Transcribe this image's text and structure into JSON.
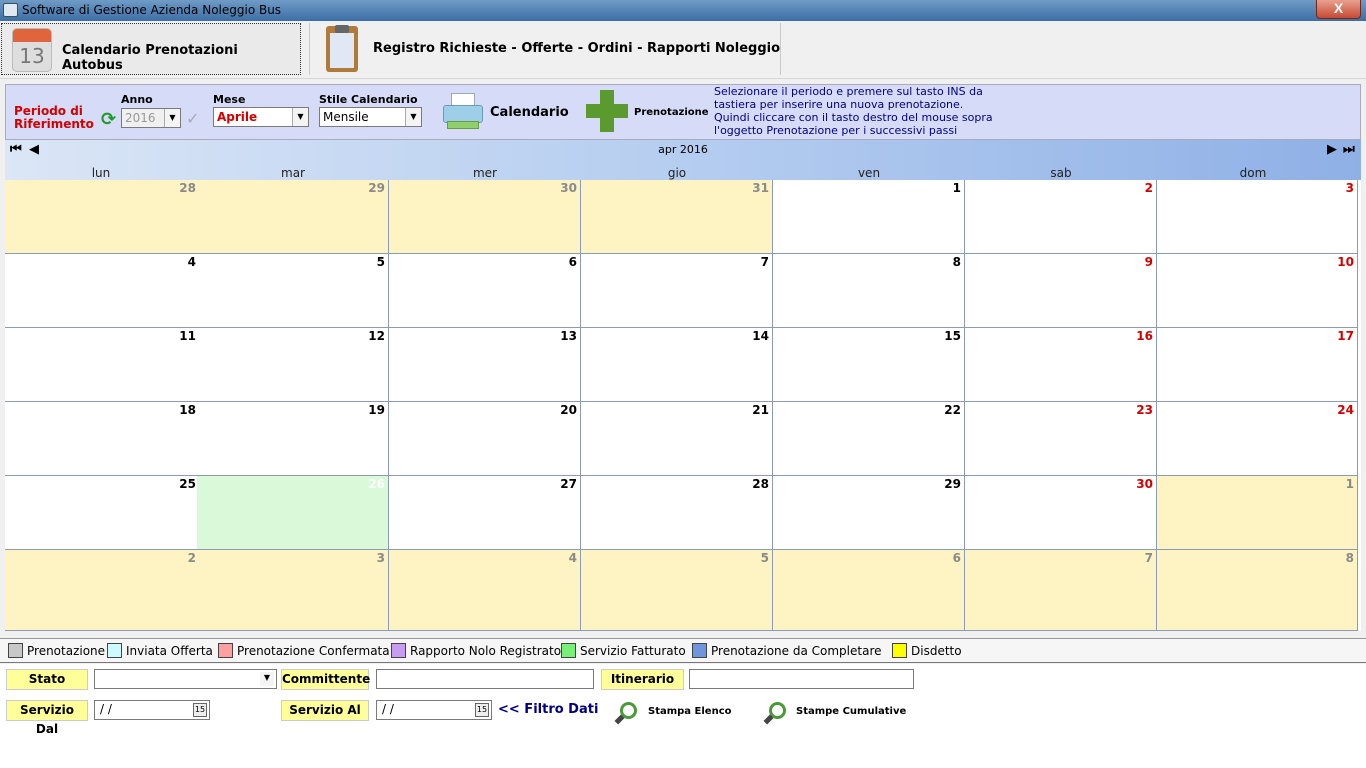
{
  "window": {
    "title": "Software di Gestione Azienda Noleggio Bus",
    "close_label": "X"
  },
  "tabs": [
    {
      "label": "Calendario Prenotazioni Autobus",
      "icon": "calendar-13-icon",
      "icon_text": "13"
    },
    {
      "label": "Registro Richieste - Offerte - Ordini - Rapporti Noleggio",
      "icon": "clipboard-icon"
    }
  ],
  "toolbar": {
    "periodo_label": "Periodo di Riferimento",
    "anno_label": "Anno",
    "anno_value": "2016",
    "mese_label": "Mese",
    "mese_value": "Aprile",
    "stile_label": "Stile Calendario",
    "stile_value": "Mensile",
    "calendario_label": "Calendario",
    "prenotazione_label": "Prenotazione",
    "info_text": "Selezionare il periodo e premere sul tasto INS da tastiera per inserire una nuova prenotazione. Quindi cliccare con il tasto destro del mouse sopra l'oggetto Prenotazione per i successivi passi",
    "info_lines": [
      "Selezionare il periodo e premere sul tasto INS da",
      "tastiera per inserire una nuova prenotazione.",
      "Quindi cliccare con il tasto destro del mouse sopra",
      "l'oggetto Prenotazione per i successivi passi"
    ]
  },
  "calendar": {
    "month_label": "apr 2016",
    "nav": {
      "first": "⏮",
      "prev": "◀",
      "next": "▶",
      "last": "⏭"
    },
    "weekdays": [
      "lun",
      "mar",
      "mer",
      "gio",
      "ven",
      "sab",
      "dom"
    ],
    "weeks": [
      [
        {
          "d": "28",
          "o": 1
        },
        {
          "d": "29",
          "o": 1
        },
        {
          "d": "30",
          "o": 1
        },
        {
          "d": "31",
          "o": 1
        },
        {
          "d": "1"
        },
        {
          "d": "2",
          "w": 1
        },
        {
          "d": "3",
          "w": 1
        }
      ],
      [
        {
          "d": "4"
        },
        {
          "d": "5"
        },
        {
          "d": "6"
        },
        {
          "d": "7"
        },
        {
          "d": "8"
        },
        {
          "d": "9",
          "w": 1
        },
        {
          "d": "10",
          "w": 1
        }
      ],
      [
        {
          "d": "11"
        },
        {
          "d": "12"
        },
        {
          "d": "13"
        },
        {
          "d": "14"
        },
        {
          "d": "15"
        },
        {
          "d": "16",
          "w": 1
        },
        {
          "d": "17",
          "w": 1
        }
      ],
      [
        {
          "d": "18"
        },
        {
          "d": "19"
        },
        {
          "d": "20"
        },
        {
          "d": "21"
        },
        {
          "d": "22"
        },
        {
          "d": "23",
          "w": 1
        },
        {
          "d": "24",
          "w": 1
        }
      ],
      [
        {
          "d": "25"
        },
        {
          "d": "26",
          "t": 1
        },
        {
          "d": "27"
        },
        {
          "d": "28"
        },
        {
          "d": "29"
        },
        {
          "d": "30",
          "w": 1
        },
        {
          "d": "1",
          "o": 1,
          "w": 1
        }
      ],
      [
        {
          "d": "2",
          "o": 1
        },
        {
          "d": "3",
          "o": 1
        },
        {
          "d": "4",
          "o": 1
        },
        {
          "d": "5",
          "o": 1
        },
        {
          "d": "6",
          "o": 1
        },
        {
          "d": "7",
          "o": 1,
          "w": 1
        },
        {
          "d": "8",
          "o": 1,
          "w": 1
        }
      ]
    ],
    "colors": {
      "other_month": "#fdf3c3",
      "today": "#d9f9d9",
      "weekend_text": "#d40000"
    }
  },
  "legend": [
    {
      "label": "Prenotazione",
      "color": "#c8c8c8"
    },
    {
      "label": "Inviata Offerta",
      "color": "#ccfaff"
    },
    {
      "label": "Prenotazione Confermata",
      "color": "#ffa0a0"
    },
    {
      "label": "Rapporto Nolo Registrato",
      "color": "#c89cf0"
    },
    {
      "label": "Servizio Fatturato",
      "color": "#78f078"
    },
    {
      "label": "Prenotazione da Completare",
      "color": "#6e96dc"
    },
    {
      "label": "Disdetto",
      "color": "#ffff00"
    }
  ],
  "filters": {
    "stato_label": "Stato",
    "stato_value": "",
    "committente_label": "Committente",
    "committente_value": "",
    "itinerario_label": "Itinerario",
    "itinerario_value": "",
    "servizio_dal_label": "Servizio Dal",
    "servizio_dal_value": "/ /",
    "servizio_al_label": "Servizio Al",
    "servizio_al_value": "/ /",
    "date_icon_text": "15",
    "filtro_label": "<< Filtro Dati",
    "stampa_elenco_label": "Stampa Elenco",
    "stampe_cumulative_label": "Stampe Cumulative"
  }
}
